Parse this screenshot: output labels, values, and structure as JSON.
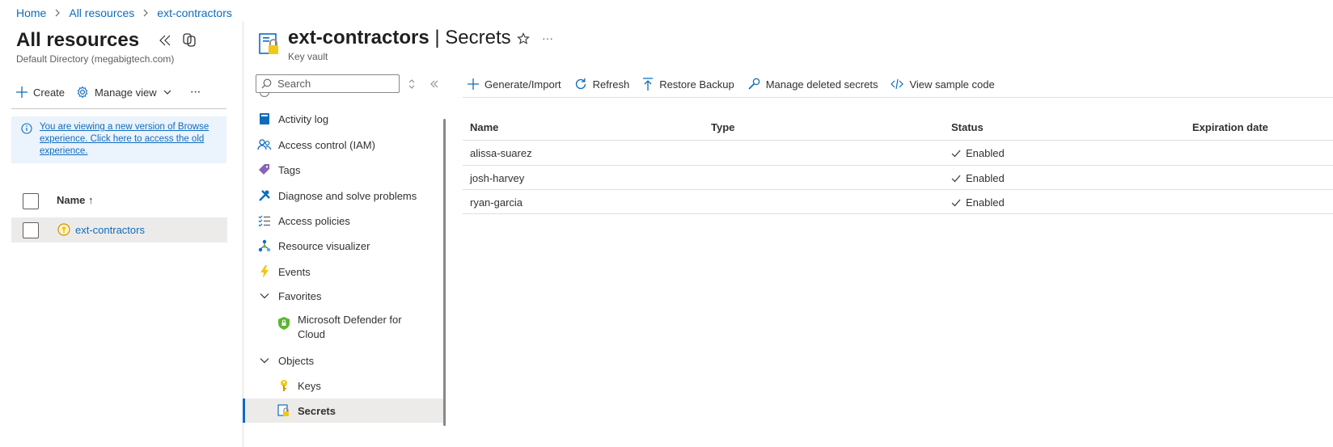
{
  "breadcrumb": {
    "home": "Home",
    "all_resources": "All resources",
    "current": "ext-contractors"
  },
  "left_blade": {
    "title": "All resources",
    "subtitle": "Default Directory (megabigtech.com)",
    "create_label": "Create",
    "manage_view_label": "Manage view",
    "more_label": "···",
    "info_banner": "You are viewing a new version of Browse experience. Click here to access the old experience.",
    "list_header": "Name ↑",
    "rows": [
      {
        "name": "ext-contractors"
      }
    ]
  },
  "resource": {
    "name": "ext-contractors",
    "section": "Secrets",
    "title_separator": "|",
    "type": "Key vault",
    "more_label": "···"
  },
  "nav": {
    "search_placeholder": "Search",
    "items": [
      {
        "label": "Activity log",
        "icon": "activity-log-icon"
      },
      {
        "label": "Access control (IAM)",
        "icon": "people-icon"
      },
      {
        "label": "Tags",
        "icon": "tag-icon"
      },
      {
        "label": "Diagnose and solve problems",
        "icon": "wrench-icon"
      },
      {
        "label": "Access policies",
        "icon": "checklist-icon"
      },
      {
        "label": "Resource visualizer",
        "icon": "hierarchy-icon"
      },
      {
        "label": "Events",
        "icon": "lightning-icon"
      },
      {
        "label": "Favorites",
        "icon": "chevron-down-icon"
      },
      {
        "label": "Microsoft Defender for Cloud",
        "icon": "shield-icon"
      },
      {
        "label": "Objects",
        "icon": "chevron-down-icon"
      },
      {
        "label": "Keys",
        "icon": "key-icon"
      },
      {
        "label": "Secrets",
        "icon": "secret-icon"
      }
    ]
  },
  "toolbar": {
    "generate_import": "Generate/Import",
    "refresh": "Refresh",
    "restore_backup": "Restore Backup",
    "manage_deleted": "Manage deleted secrets",
    "view_sample": "View sample code"
  },
  "table": {
    "columns": [
      "Name",
      "Type",
      "Status",
      "Expiration date"
    ],
    "rows": [
      {
        "name": "alissa-suarez",
        "type": "",
        "status": "Enabled",
        "expiration": ""
      },
      {
        "name": "josh-harvey",
        "type": "",
        "status": "Enabled",
        "expiration": ""
      },
      {
        "name": "ryan-garcia",
        "type": "",
        "status": "Enabled",
        "expiration": ""
      }
    ]
  },
  "colors": {
    "accent": "#0f6cbd",
    "selected_bg": "#edebe9",
    "banner_bg": "#ebf3fc",
    "key_yellow": "#f2c811"
  }
}
